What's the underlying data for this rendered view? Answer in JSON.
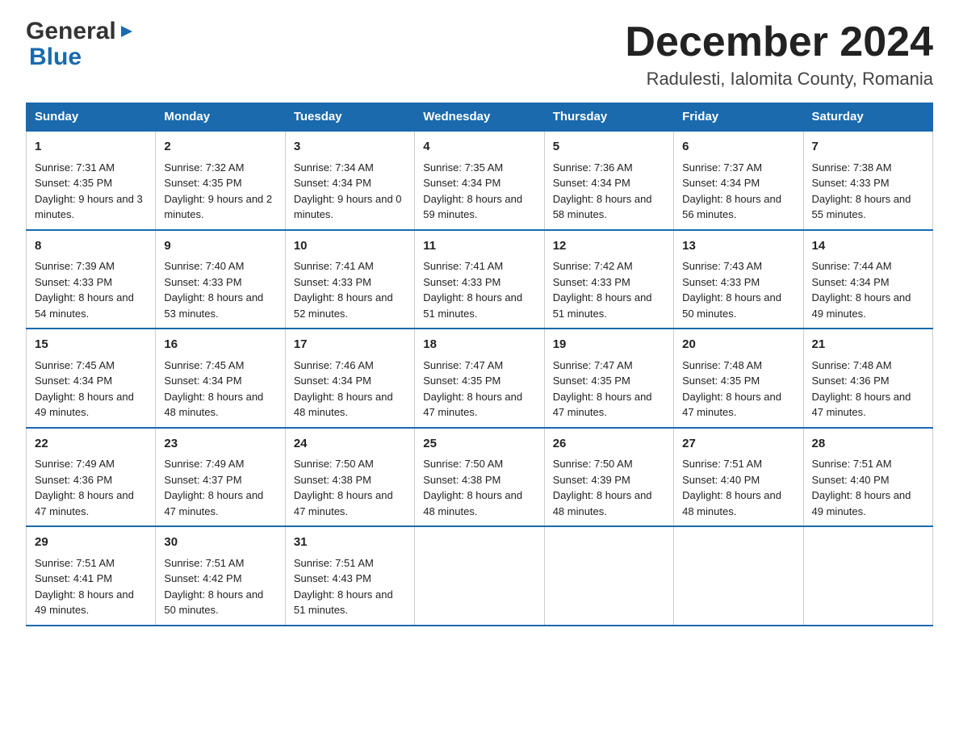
{
  "logo": {
    "line1": "General",
    "arrow": "▶",
    "line2": "Blue"
  },
  "header": {
    "title": "December 2024",
    "subtitle": "Radulesti, Ialomita County, Romania"
  },
  "weekdays": [
    "Sunday",
    "Monday",
    "Tuesday",
    "Wednesday",
    "Thursday",
    "Friday",
    "Saturday"
  ],
  "weeks": [
    [
      {
        "day": "1",
        "sunrise": "7:31 AM",
        "sunset": "4:35 PM",
        "daylight": "9 hours and 3 minutes."
      },
      {
        "day": "2",
        "sunrise": "7:32 AM",
        "sunset": "4:35 PM",
        "daylight": "9 hours and 2 minutes."
      },
      {
        "day": "3",
        "sunrise": "7:34 AM",
        "sunset": "4:34 PM",
        "daylight": "9 hours and 0 minutes."
      },
      {
        "day": "4",
        "sunrise": "7:35 AM",
        "sunset": "4:34 PM",
        "daylight": "8 hours and 59 minutes."
      },
      {
        "day": "5",
        "sunrise": "7:36 AM",
        "sunset": "4:34 PM",
        "daylight": "8 hours and 58 minutes."
      },
      {
        "day": "6",
        "sunrise": "7:37 AM",
        "sunset": "4:34 PM",
        "daylight": "8 hours and 56 minutes."
      },
      {
        "day": "7",
        "sunrise": "7:38 AM",
        "sunset": "4:33 PM",
        "daylight": "8 hours and 55 minutes."
      }
    ],
    [
      {
        "day": "8",
        "sunrise": "7:39 AM",
        "sunset": "4:33 PM",
        "daylight": "8 hours and 54 minutes."
      },
      {
        "day": "9",
        "sunrise": "7:40 AM",
        "sunset": "4:33 PM",
        "daylight": "8 hours and 53 minutes."
      },
      {
        "day": "10",
        "sunrise": "7:41 AM",
        "sunset": "4:33 PM",
        "daylight": "8 hours and 52 minutes."
      },
      {
        "day": "11",
        "sunrise": "7:41 AM",
        "sunset": "4:33 PM",
        "daylight": "8 hours and 51 minutes."
      },
      {
        "day": "12",
        "sunrise": "7:42 AM",
        "sunset": "4:33 PM",
        "daylight": "8 hours and 51 minutes."
      },
      {
        "day": "13",
        "sunrise": "7:43 AM",
        "sunset": "4:33 PM",
        "daylight": "8 hours and 50 minutes."
      },
      {
        "day": "14",
        "sunrise": "7:44 AM",
        "sunset": "4:34 PM",
        "daylight": "8 hours and 49 minutes."
      }
    ],
    [
      {
        "day": "15",
        "sunrise": "7:45 AM",
        "sunset": "4:34 PM",
        "daylight": "8 hours and 49 minutes."
      },
      {
        "day": "16",
        "sunrise": "7:45 AM",
        "sunset": "4:34 PM",
        "daylight": "8 hours and 48 minutes."
      },
      {
        "day": "17",
        "sunrise": "7:46 AM",
        "sunset": "4:34 PM",
        "daylight": "8 hours and 48 minutes."
      },
      {
        "day": "18",
        "sunrise": "7:47 AM",
        "sunset": "4:35 PM",
        "daylight": "8 hours and 47 minutes."
      },
      {
        "day": "19",
        "sunrise": "7:47 AM",
        "sunset": "4:35 PM",
        "daylight": "8 hours and 47 minutes."
      },
      {
        "day": "20",
        "sunrise": "7:48 AM",
        "sunset": "4:35 PM",
        "daylight": "8 hours and 47 minutes."
      },
      {
        "day": "21",
        "sunrise": "7:48 AM",
        "sunset": "4:36 PM",
        "daylight": "8 hours and 47 minutes."
      }
    ],
    [
      {
        "day": "22",
        "sunrise": "7:49 AM",
        "sunset": "4:36 PM",
        "daylight": "8 hours and 47 minutes."
      },
      {
        "day": "23",
        "sunrise": "7:49 AM",
        "sunset": "4:37 PM",
        "daylight": "8 hours and 47 minutes."
      },
      {
        "day": "24",
        "sunrise": "7:50 AM",
        "sunset": "4:38 PM",
        "daylight": "8 hours and 47 minutes."
      },
      {
        "day": "25",
        "sunrise": "7:50 AM",
        "sunset": "4:38 PM",
        "daylight": "8 hours and 48 minutes."
      },
      {
        "day": "26",
        "sunrise": "7:50 AM",
        "sunset": "4:39 PM",
        "daylight": "8 hours and 48 minutes."
      },
      {
        "day": "27",
        "sunrise": "7:51 AM",
        "sunset": "4:40 PM",
        "daylight": "8 hours and 48 minutes."
      },
      {
        "day": "28",
        "sunrise": "7:51 AM",
        "sunset": "4:40 PM",
        "daylight": "8 hours and 49 minutes."
      }
    ],
    [
      {
        "day": "29",
        "sunrise": "7:51 AM",
        "sunset": "4:41 PM",
        "daylight": "8 hours and 49 minutes."
      },
      {
        "day": "30",
        "sunrise": "7:51 AM",
        "sunset": "4:42 PM",
        "daylight": "8 hours and 50 minutes."
      },
      {
        "day": "31",
        "sunrise": "7:51 AM",
        "sunset": "4:43 PM",
        "daylight": "8 hours and 51 minutes."
      },
      null,
      null,
      null,
      null
    ]
  ],
  "labels": {
    "sunrise": "Sunrise: ",
    "sunset": "Sunset: ",
    "daylight": "Daylight: "
  }
}
